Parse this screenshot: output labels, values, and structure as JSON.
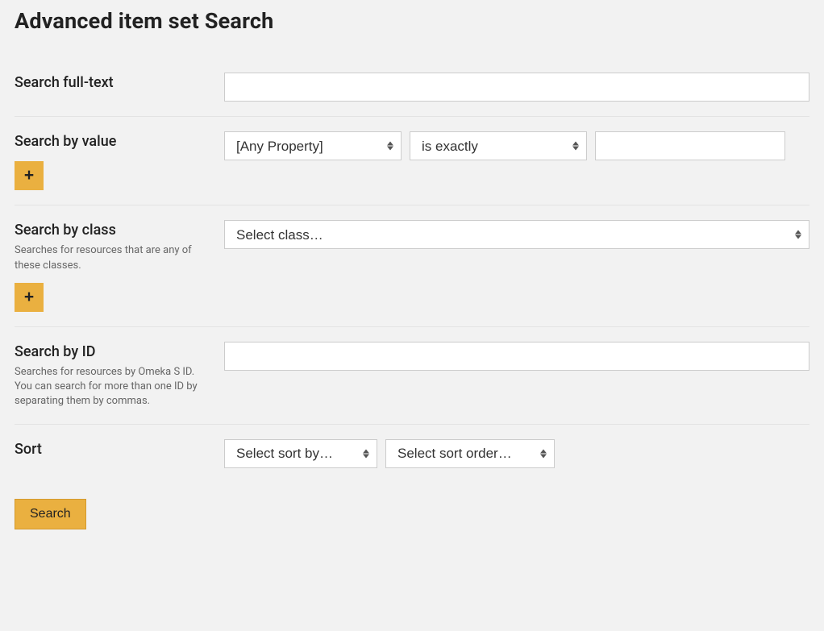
{
  "page_title": "Advanced item set Search",
  "fields": {
    "fulltext": {
      "label": "Search full-text",
      "value": ""
    },
    "by_value": {
      "label": "Search by value",
      "property_selected": "[Any Property]",
      "operator_selected": "is exactly",
      "text_value": "",
      "add_label": "+"
    },
    "by_class": {
      "label": "Search by class",
      "desc": "Searches for resources that are any of these classes.",
      "select_placeholder": "Select class…",
      "add_label": "+"
    },
    "by_id": {
      "label": "Search by ID",
      "desc": "Searches for resources by Omeka S ID. You can search for more than one ID by separating them by commas.",
      "value": ""
    },
    "sort": {
      "label": "Sort",
      "sort_by_placeholder": "Select sort by…",
      "sort_order_placeholder": "Select sort order…"
    }
  },
  "submit_label": "Search"
}
